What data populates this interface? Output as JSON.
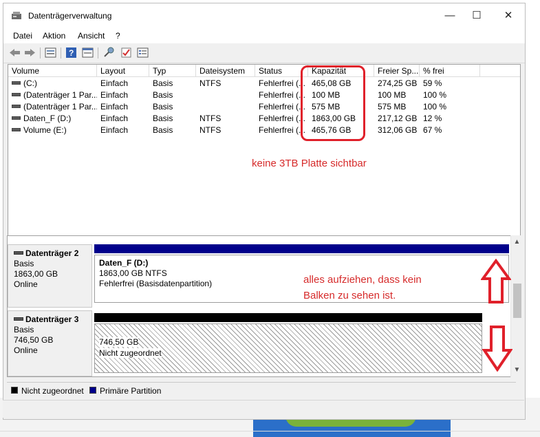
{
  "window": {
    "title": "Datenträgerverwaltung",
    "minimize": "—",
    "maximize": "☐",
    "close": "✕"
  },
  "menu": [
    "Datei",
    "Aktion",
    "Ansicht",
    "?"
  ],
  "list": {
    "columns": [
      "Volume",
      "Layout",
      "Typ",
      "Dateisystem",
      "Status",
      "Kapazität",
      "Freier Sp...",
      "% frei"
    ],
    "rows": [
      [
        "(C:)",
        "Einfach",
        "Basis",
        "NTFS",
        "Fehlerfrei (...",
        "465,08 GB",
        "274,25 GB",
        "59 %"
      ],
      [
        "(Datenträger 1 Par...",
        "Einfach",
        "Basis",
        "",
        "Fehlerfrei (...",
        "100 MB",
        "100 MB",
        "100 %"
      ],
      [
        "(Datenträger 1 Par...",
        "Einfach",
        "Basis",
        "",
        "Fehlerfrei (...",
        "575 MB",
        "575 MB",
        "100 %"
      ],
      [
        "Daten_F (D:)",
        "Einfach",
        "Basis",
        "NTFS",
        "Fehlerfrei (...",
        "1863,00 GB",
        "217,12 GB",
        "12 %"
      ],
      [
        "Volume (E:)",
        "Einfach",
        "Basis",
        "NTFS",
        "Fehlerfrei (...",
        "465,76 GB",
        "312,06 GB",
        "67 %"
      ]
    ]
  },
  "annotations": {
    "note1": "keine 3TB Platte sichtbar",
    "note2_line1": "alles aufziehen, dass kein",
    "note2_line2": "Balken zu sehen ist.",
    "color": "#d62a2a"
  },
  "disks": [
    {
      "name": "Datenträger 2",
      "type": "Basis",
      "size": "1863,00 GB",
      "state": "Online",
      "partition": {
        "name": "Daten_F  (D:)",
        "info": "1863,00 GB NTFS",
        "status": "Fehlerfrei (Basisdatenpartition)",
        "bar_color": "#00008b"
      }
    },
    {
      "name": "Datenträger 3",
      "type": "Basis",
      "size": "746,50 GB",
      "state": "Online",
      "partition": {
        "size": "746,50 GB",
        "status": "Nicht zugeordnet",
        "bar_color": "#000000"
      }
    }
  ],
  "legend": [
    {
      "label": "Nicht zugeordnet",
      "color": "#000000"
    },
    {
      "label": "Primäre Partition",
      "color": "#00008b"
    }
  ]
}
